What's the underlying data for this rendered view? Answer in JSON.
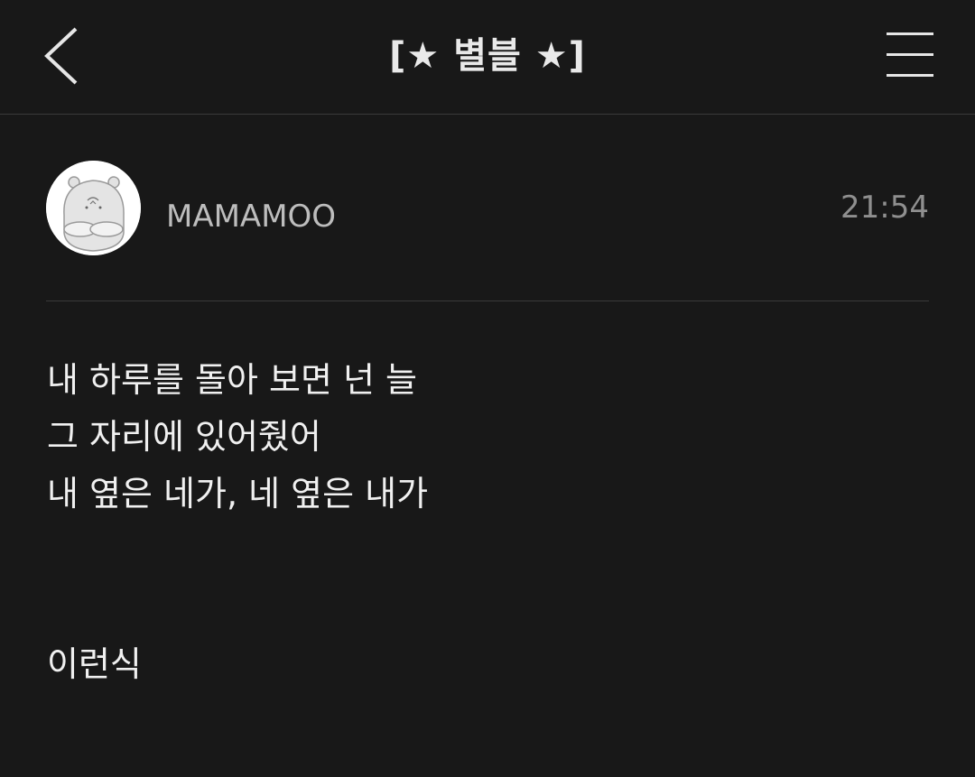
{
  "header": {
    "title": "[★ 별블 ★]",
    "back_icon": "chevron-left-icon",
    "menu_icon": "hamburger-menu-icon"
  },
  "post": {
    "author": "MAMAMOO",
    "time": "21:54",
    "avatar_icon": "hamster-avatar-icon",
    "lines": [
      "내 하루를 돌아 보면 넌 늘",
      "그 자리에 있어줬어",
      "내 옆은 네가, 네 옆은 내가",
      "",
      "",
      "이런식"
    ]
  },
  "colors": {
    "background": "#181818",
    "text": "#f0f0f0",
    "muted": "#8f8f8f",
    "divider": "#3a3a3a"
  }
}
